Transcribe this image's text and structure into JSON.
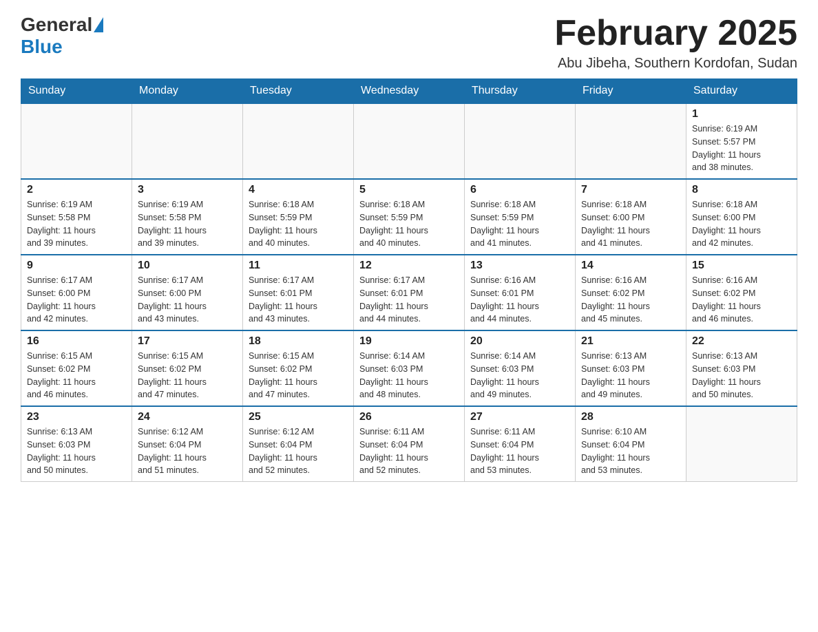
{
  "header": {
    "logo_general": "General",
    "logo_blue": "Blue",
    "month_title": "February 2025",
    "location": "Abu Jibeha, Southern Kordofan, Sudan"
  },
  "days_of_week": [
    "Sunday",
    "Monday",
    "Tuesday",
    "Wednesday",
    "Thursday",
    "Friday",
    "Saturday"
  ],
  "weeks": [
    [
      {
        "day": "",
        "info": ""
      },
      {
        "day": "",
        "info": ""
      },
      {
        "day": "",
        "info": ""
      },
      {
        "day": "",
        "info": ""
      },
      {
        "day": "",
        "info": ""
      },
      {
        "day": "",
        "info": ""
      },
      {
        "day": "1",
        "info": "Sunrise: 6:19 AM\nSunset: 5:57 PM\nDaylight: 11 hours\nand 38 minutes."
      }
    ],
    [
      {
        "day": "2",
        "info": "Sunrise: 6:19 AM\nSunset: 5:58 PM\nDaylight: 11 hours\nand 39 minutes."
      },
      {
        "day": "3",
        "info": "Sunrise: 6:19 AM\nSunset: 5:58 PM\nDaylight: 11 hours\nand 39 minutes."
      },
      {
        "day": "4",
        "info": "Sunrise: 6:18 AM\nSunset: 5:59 PM\nDaylight: 11 hours\nand 40 minutes."
      },
      {
        "day": "5",
        "info": "Sunrise: 6:18 AM\nSunset: 5:59 PM\nDaylight: 11 hours\nand 40 minutes."
      },
      {
        "day": "6",
        "info": "Sunrise: 6:18 AM\nSunset: 5:59 PM\nDaylight: 11 hours\nand 41 minutes."
      },
      {
        "day": "7",
        "info": "Sunrise: 6:18 AM\nSunset: 6:00 PM\nDaylight: 11 hours\nand 41 minutes."
      },
      {
        "day": "8",
        "info": "Sunrise: 6:18 AM\nSunset: 6:00 PM\nDaylight: 11 hours\nand 42 minutes."
      }
    ],
    [
      {
        "day": "9",
        "info": "Sunrise: 6:17 AM\nSunset: 6:00 PM\nDaylight: 11 hours\nand 42 minutes."
      },
      {
        "day": "10",
        "info": "Sunrise: 6:17 AM\nSunset: 6:00 PM\nDaylight: 11 hours\nand 43 minutes."
      },
      {
        "day": "11",
        "info": "Sunrise: 6:17 AM\nSunset: 6:01 PM\nDaylight: 11 hours\nand 43 minutes."
      },
      {
        "day": "12",
        "info": "Sunrise: 6:17 AM\nSunset: 6:01 PM\nDaylight: 11 hours\nand 44 minutes."
      },
      {
        "day": "13",
        "info": "Sunrise: 6:16 AM\nSunset: 6:01 PM\nDaylight: 11 hours\nand 44 minutes."
      },
      {
        "day": "14",
        "info": "Sunrise: 6:16 AM\nSunset: 6:02 PM\nDaylight: 11 hours\nand 45 minutes."
      },
      {
        "day": "15",
        "info": "Sunrise: 6:16 AM\nSunset: 6:02 PM\nDaylight: 11 hours\nand 46 minutes."
      }
    ],
    [
      {
        "day": "16",
        "info": "Sunrise: 6:15 AM\nSunset: 6:02 PM\nDaylight: 11 hours\nand 46 minutes."
      },
      {
        "day": "17",
        "info": "Sunrise: 6:15 AM\nSunset: 6:02 PM\nDaylight: 11 hours\nand 47 minutes."
      },
      {
        "day": "18",
        "info": "Sunrise: 6:15 AM\nSunset: 6:02 PM\nDaylight: 11 hours\nand 47 minutes."
      },
      {
        "day": "19",
        "info": "Sunrise: 6:14 AM\nSunset: 6:03 PM\nDaylight: 11 hours\nand 48 minutes."
      },
      {
        "day": "20",
        "info": "Sunrise: 6:14 AM\nSunset: 6:03 PM\nDaylight: 11 hours\nand 49 minutes."
      },
      {
        "day": "21",
        "info": "Sunrise: 6:13 AM\nSunset: 6:03 PM\nDaylight: 11 hours\nand 49 minutes."
      },
      {
        "day": "22",
        "info": "Sunrise: 6:13 AM\nSunset: 6:03 PM\nDaylight: 11 hours\nand 50 minutes."
      }
    ],
    [
      {
        "day": "23",
        "info": "Sunrise: 6:13 AM\nSunset: 6:03 PM\nDaylight: 11 hours\nand 50 minutes."
      },
      {
        "day": "24",
        "info": "Sunrise: 6:12 AM\nSunset: 6:04 PM\nDaylight: 11 hours\nand 51 minutes."
      },
      {
        "day": "25",
        "info": "Sunrise: 6:12 AM\nSunset: 6:04 PM\nDaylight: 11 hours\nand 52 minutes."
      },
      {
        "day": "26",
        "info": "Sunrise: 6:11 AM\nSunset: 6:04 PM\nDaylight: 11 hours\nand 52 minutes."
      },
      {
        "day": "27",
        "info": "Sunrise: 6:11 AM\nSunset: 6:04 PM\nDaylight: 11 hours\nand 53 minutes."
      },
      {
        "day": "28",
        "info": "Sunrise: 6:10 AM\nSunset: 6:04 PM\nDaylight: 11 hours\nand 53 minutes."
      },
      {
        "day": "",
        "info": ""
      }
    ]
  ]
}
